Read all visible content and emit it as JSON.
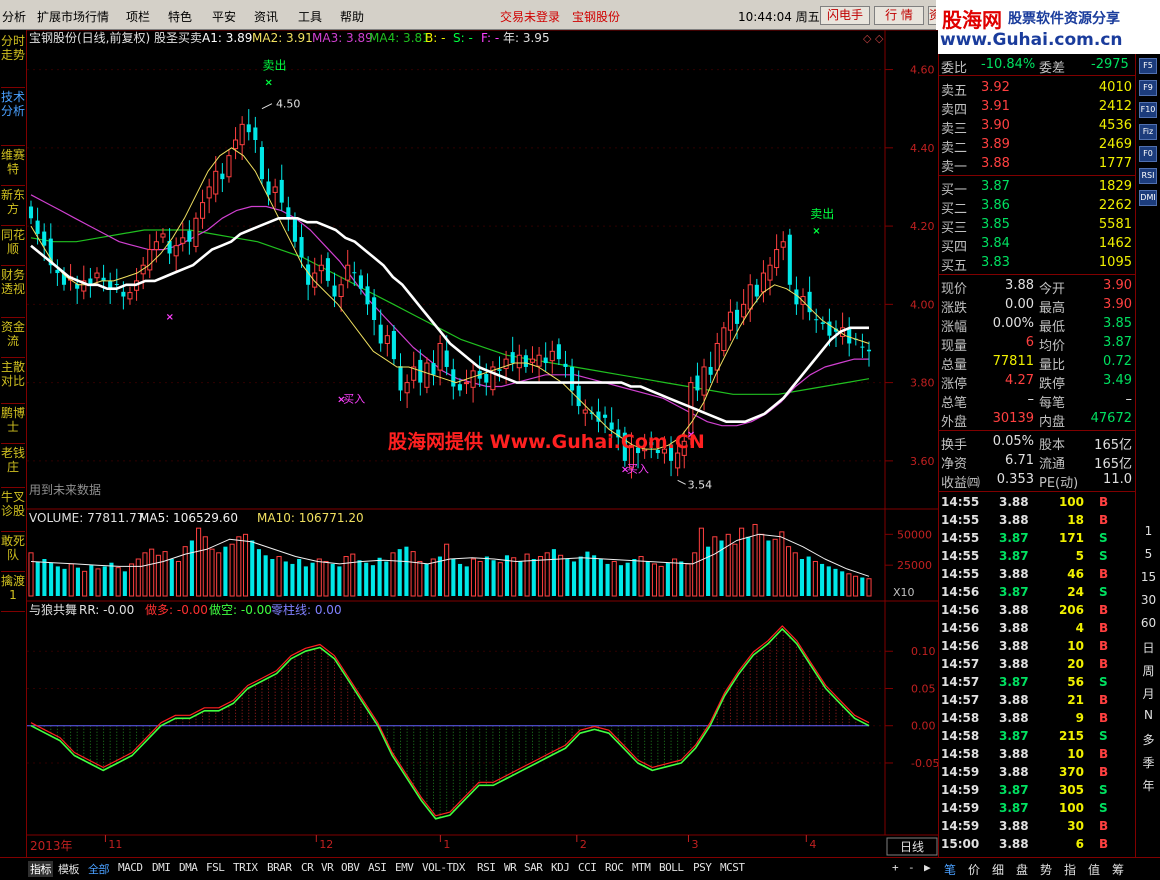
{
  "menu": {
    "items": [
      "分析",
      "扩展市场行情",
      "项栏",
      "特色",
      "平安",
      "资讯",
      "工具",
      "帮助"
    ],
    "trade_status": "交易未登录",
    "stock_name": "宝钢股份",
    "clock": "10:44:04 周五",
    "buttons": [
      "闪电手",
      "行 情",
      "资"
    ]
  },
  "logo": {
    "brand": "股海网",
    "slogan": "股票软件资源分享",
    "url": "www.Guhai.com.cn"
  },
  "left_tabs": [
    "分时走势",
    "技术分析",
    "维赛特",
    "新东方",
    "同花顺",
    "财务透视",
    "资金流",
    "主散对比",
    "鹏博士",
    "老钱庄",
    "牛叉诊股",
    "敢死队",
    "擒渡1"
  ],
  "main_header": {
    "title": "宝钢股份(日线,前复权) 股圣买卖",
    "a1": "A1: 3.89",
    "ma2": "MA2: 3.91",
    "ma3": "MA3: 3.89",
    "ma4": "MA4: 3.81",
    "b": "B: -",
    "s": "S: -",
    "f": "F: -",
    "year": "年: 3.95",
    "future_note": "用到未来数据",
    "watermark": "股海网提供 Www.Guhai.Com.CN"
  },
  "annotations": {
    "sell": "卖出",
    "buy": "买入",
    "high": "4.50",
    "low": "3.54",
    "corner_icons": "◇ ◇"
  },
  "volume_header": {
    "label": "VOLUME: 77811.77",
    "ma5": "MA5: 106529.60",
    "ma10": "MA10: 106771.20",
    "unit": "X10"
  },
  "osc_header": {
    "label": "与狼共舞",
    "rr": "RR: -0.00",
    "long": "做多: -0.00",
    "short": "做空: -0.00",
    "zero": "零柱线: 0.00"
  },
  "time_axis": {
    "year_label": "2013年",
    "months": [
      "11",
      "12",
      "1",
      "2",
      "3",
      "4"
    ],
    "period": "日线"
  },
  "colors": {
    "up": "#ff4040",
    "down": "#00e8e8",
    "ma_white": "#ffffff",
    "ma_yellow": "#f0e060",
    "ma_magenta": "#d040d0",
    "ma_green": "#20c020",
    "sell_signal": "#00ff40",
    "buy_signal": "#ff40ff",
    "osc_red": "#ff2020",
    "osc_green": "#40ff40",
    "zero_line": "#6060ff"
  },
  "quote": {
    "weibi": {
      "label": "委比",
      "value": "-10.84%",
      "weicha_label": "委差",
      "weicha": "-2975"
    },
    "asks": [
      {
        "label": "卖五",
        "price": "3.92",
        "vol": "4010"
      },
      {
        "label": "卖四",
        "price": "3.91",
        "vol": "2412"
      },
      {
        "label": "卖三",
        "price": "3.90",
        "vol": "4536"
      },
      {
        "label": "卖二",
        "price": "3.89",
        "vol": "2469"
      },
      {
        "label": "卖一",
        "price": "3.88",
        "vol": "1777"
      }
    ],
    "bids": [
      {
        "label": "买一",
        "price": "3.87",
        "vol": "1829"
      },
      {
        "label": "买二",
        "price": "3.86",
        "vol": "2262"
      },
      {
        "label": "买三",
        "price": "3.85",
        "vol": "5581"
      },
      {
        "label": "买四",
        "price": "3.84",
        "vol": "1462"
      },
      {
        "label": "买五",
        "price": "3.83",
        "vol": "1095"
      }
    ],
    "stats": [
      {
        "l1": "现价",
        "v1": "3.88",
        "c1": "wht",
        "l2": "今开",
        "v2": "3.90",
        "c2": "red"
      },
      {
        "l1": "涨跌",
        "v1": "0.00",
        "c1": "wht",
        "l2": "最高",
        "v2": "3.90",
        "c2": "red"
      },
      {
        "l1": "涨幅",
        "v1": "0.00%",
        "c1": "wht",
        "l2": "最低",
        "v2": "3.85",
        "c2": "grn"
      },
      {
        "l1": "现量",
        "v1": "6",
        "c1": "red",
        "l2": "均价",
        "v2": "3.87",
        "c2": "grn"
      },
      {
        "l1": "总量",
        "v1": "77811",
        "c1": "yel",
        "l2": "量比",
        "v2": "0.72",
        "c2": "grn"
      },
      {
        "l1": "涨停",
        "v1": "4.27",
        "c1": "red",
        "l2": "跌停",
        "v2": "3.49",
        "c2": "grn"
      },
      {
        "l1": "总笔",
        "v1": "–",
        "c1": "wht",
        "l2": "每笔",
        "v2": "–",
        "c2": "wht"
      },
      {
        "l1": "外盘",
        "v1": "30139",
        "c1": "red",
        "l2": "内盘",
        "v2": "47672",
        "c2": "grn"
      }
    ],
    "fin": [
      {
        "l1": "换手",
        "v1": "0.05%",
        "l2": "股本",
        "v2": "165亿"
      },
      {
        "l1": "净资",
        "v1": "6.71",
        "l2": "流通",
        "v2": "165亿"
      },
      {
        "l1": "收益㈣",
        "v1": "0.353",
        "l2": "PE(动)",
        "v2": "11.0"
      }
    ],
    "ticks": [
      {
        "t": "14:55",
        "p": "3.88",
        "v": "100",
        "s": "B"
      },
      {
        "t": "14:55",
        "p": "3.88",
        "v": "18",
        "s": "B"
      },
      {
        "t": "14:55",
        "p": "3.87",
        "v": "171",
        "s": "S"
      },
      {
        "t": "14:55",
        "p": "3.87",
        "v": "5",
        "s": "S"
      },
      {
        "t": "14:55",
        "p": "3.88",
        "v": "46",
        "s": "B"
      },
      {
        "t": "14:56",
        "p": "3.87",
        "v": "24",
        "s": "S"
      },
      {
        "t": "14:56",
        "p": "3.88",
        "v": "206",
        "s": "B"
      },
      {
        "t": "14:56",
        "p": "3.88",
        "v": "4",
        "s": "B"
      },
      {
        "t": "14:56",
        "p": "3.88",
        "v": "10",
        "s": "B"
      },
      {
        "t": "14:57",
        "p": "3.88",
        "v": "20",
        "s": "B"
      },
      {
        "t": "14:57",
        "p": "3.87",
        "v": "56",
        "s": "S"
      },
      {
        "t": "14:57",
        "p": "3.88",
        "v": "21",
        "s": "B"
      },
      {
        "t": "14:58",
        "p": "3.88",
        "v": "9",
        "s": "B"
      },
      {
        "t": "14:58",
        "p": "3.87",
        "v": "215",
        "s": "S"
      },
      {
        "t": "14:58",
        "p": "3.88",
        "v": "10",
        "s": "B"
      },
      {
        "t": "14:59",
        "p": "3.88",
        "v": "370",
        "s": "B"
      },
      {
        "t": "14:59",
        "p": "3.87",
        "v": "305",
        "s": "S"
      },
      {
        "t": "14:59",
        "p": "3.87",
        "v": "100",
        "s": "S"
      },
      {
        "t": "14:59",
        "p": "3.88",
        "v": "30",
        "s": "B"
      },
      {
        "t": "15:00",
        "p": "3.88",
        "v": "6",
        "s": "B"
      }
    ]
  },
  "right_icons": [
    "F5",
    "F9",
    "F10",
    "Fiz",
    "F0",
    "RSI",
    "DMI"
  ],
  "right_periods": [
    "1",
    "5",
    "15",
    "30",
    "60",
    "日",
    "周",
    "月",
    "N",
    "多",
    "季",
    "年"
  ],
  "bottom_tabs": [
    "指标",
    "模板",
    "全部",
    "MACD",
    "DMI",
    "DMA",
    "FSL",
    "TRIX",
    "BRAR",
    "CR",
    "VR",
    "OBV",
    "ASI",
    "EMV",
    "VOL-TDX",
    "RSI",
    "WR",
    "SAR",
    "KDJ",
    "CCI",
    "ROC",
    "MTM",
    "BOLL",
    "PSY",
    "MCST"
  ],
  "bottom_right": [
    "笔",
    "价",
    "细",
    "盘",
    "势",
    "指",
    "值",
    "筹"
  ],
  "bottom_nav": [
    "+",
    "-",
    "▶"
  ],
  "chart_data": [
    {
      "type": "candlestick",
      "title": "宝钢股份(日线,前复权) 股圣买卖",
      "ylim": [
        3.5,
        4.65
      ],
      "yticks": [
        3.6,
        3.8,
        4.0,
        4.2,
        4.4,
        4.6
      ],
      "ytick_labels": [
        "3.60",
        "3.80",
        "4.00",
        "4.20",
        "4.40",
        "4.60"
      ],
      "closes": [
        4.22,
        4.18,
        4.15,
        4.1,
        4.08,
        4.05,
        4.07,
        4.04,
        4.06,
        4.05,
        4.08,
        4.06,
        4.04,
        4.05,
        4.02,
        4.03,
        4.06,
        4.1,
        4.14,
        4.16,
        4.18,
        4.13,
        4.15,
        4.17,
        4.16,
        4.22,
        4.26,
        4.3,
        4.34,
        4.32,
        4.38,
        4.42,
        4.46,
        4.44,
        4.42,
        4.32,
        4.28,
        4.3,
        4.26,
        4.22,
        4.16,
        4.12,
        4.05,
        4.08,
        4.1,
        4.06,
        4.02,
        4.05,
        4.1,
        4.08,
        4.04,
        4.0,
        3.96,
        3.9,
        3.92,
        3.86,
        3.78,
        3.8,
        3.84,
        3.8,
        3.85,
        3.82,
        3.9,
        3.84,
        3.79,
        3.78,
        3.8,
        3.83,
        3.81,
        3.8,
        3.84,
        3.83,
        3.86,
        3.85,
        3.87,
        3.84,
        3.86,
        3.87,
        3.85,
        3.88,
        3.86,
        3.84,
        3.78,
        3.74,
        3.73,
        3.72,
        3.7,
        3.71,
        3.68,
        3.66,
        3.6,
        3.64,
        3.62,
        3.63,
        3.64,
        3.62,
        3.63,
        3.6,
        3.62,
        3.65,
        3.8,
        3.78,
        3.84,
        3.82,
        3.9,
        3.94,
        3.98,
        3.95,
        4.0,
        4.05,
        4.02,
        4.08,
        4.1,
        4.14,
        4.16,
        4.05,
        4.0,
        4.02,
        3.98,
        3.96,
        3.95,
        3.92,
        3.93,
        3.94,
        3.9,
        3.91,
        3.89,
        3.88
      ],
      "ma_white": [
        4.15,
        4.13,
        4.11,
        4.09,
        4.07,
        4.06,
        4.05,
        4.05,
        4.04,
        4.04,
        4.05,
        4.05,
        4.06,
        4.06,
        4.07,
        4.08,
        4.09,
        4.1,
        4.12,
        4.14,
        4.15,
        4.16,
        4.18,
        4.19,
        4.2,
        4.21,
        4.22,
        4.22,
        4.22,
        4.21,
        4.21,
        4.2,
        4.19,
        4.17,
        4.16,
        4.14,
        4.12,
        4.1,
        4.07,
        4.05,
        4.02,
        3.99,
        3.96,
        3.93,
        3.9,
        3.88,
        3.86,
        3.84,
        3.83,
        3.82,
        3.81,
        3.8,
        3.8,
        3.8,
        3.8,
        3.8,
        3.8,
        3.8,
        3.8,
        3.8,
        3.8,
        3.8,
        3.8,
        3.79,
        3.79,
        3.78,
        3.77,
        3.76,
        3.75,
        3.74,
        3.73,
        3.72,
        3.71,
        3.7,
        3.7,
        3.7,
        3.71,
        3.72,
        3.74,
        3.76,
        3.79,
        3.82,
        3.85,
        3.88,
        3.91,
        3.93,
        3.94,
        3.94,
        3.94
      ],
      "ma_yellow": [
        4.2,
        4.15,
        4.1,
        4.07,
        4.05,
        4.05,
        4.06,
        4.06,
        4.07,
        4.08,
        4.1,
        4.13,
        4.17,
        4.22,
        4.28,
        4.34,
        4.38,
        4.4,
        4.38,
        4.34,
        4.28,
        4.22,
        4.16,
        4.1,
        4.06,
        4.03,
        4.0,
        3.96,
        3.92,
        3.88,
        3.86,
        3.84,
        3.84,
        3.83,
        3.82,
        3.81,
        3.8,
        3.81,
        3.82,
        3.83,
        3.84,
        3.85,
        3.85,
        3.84,
        3.82,
        3.8,
        3.77,
        3.74,
        3.71,
        3.68,
        3.66,
        3.64,
        3.63,
        3.63,
        3.64,
        3.66,
        3.7,
        3.75,
        3.82,
        3.88,
        3.94,
        3.99,
        4.03,
        4.05,
        4.04,
        4.02,
        3.99,
        3.96,
        3.94,
        3.92,
        3.91,
        3.9
      ],
      "ma_magenta": [
        4.28,
        4.26,
        4.24,
        4.22,
        4.2,
        4.18,
        4.16,
        4.15,
        4.14,
        4.14,
        4.15,
        4.17,
        4.19,
        4.22,
        4.24,
        4.25,
        4.25,
        4.24,
        4.22,
        4.19,
        4.15,
        4.11,
        4.06,
        4.01,
        3.97,
        3.93,
        3.89,
        3.86,
        3.83,
        3.81,
        3.8,
        3.79,
        3.79,
        3.8,
        3.81,
        3.82,
        3.82,
        3.82,
        3.81,
        3.8,
        3.79,
        3.78,
        3.77,
        3.76,
        3.74,
        3.72,
        3.7,
        3.69,
        3.69,
        3.7,
        3.72,
        3.75,
        3.79,
        3.82,
        3.84,
        3.85,
        3.86,
        3.86
      ],
      "ma_green": [
        4.17,
        4.16,
        4.16,
        4.17,
        4.18,
        4.19,
        4.19,
        4.19,
        4.18,
        4.17,
        4.16,
        4.14,
        4.12,
        4.09,
        4.06,
        4.03,
        4.0,
        3.97,
        3.94,
        3.91,
        3.89,
        3.87,
        3.86,
        3.85,
        3.84,
        3.83,
        3.82,
        3.81,
        3.8,
        3.79,
        3.78,
        3.77,
        3.77,
        3.77,
        3.78,
        3.79,
        3.8,
        3.81
      ],
      "buy_signals": [
        [
          21,
          3.97
        ],
        [
          47,
          3.76
        ],
        [
          90,
          3.58
        ],
        [
          100,
          3.67
        ]
      ],
      "sell_signals": [
        [
          36,
          4.57
        ],
        [
          119,
          4.19
        ]
      ],
      "high_label": {
        "index": 35,
        "value": 4.5
      },
      "low_label": {
        "index": 98,
        "value": 3.54
      }
    },
    {
      "type": "bar",
      "name": "VOLUME",
      "ylim": [
        0,
        60000
      ],
      "yticks": [
        25000,
        50000
      ],
      "ytick_labels": [
        "25000",
        "50000"
      ],
      "values": [
        35000,
        28000,
        30000,
        27000,
        24000,
        22000,
        26000,
        23000,
        20000,
        25000,
        22000,
        24000,
        27000,
        23000,
        20000,
        26000,
        30000,
        35000,
        38000,
        33000,
        36000,
        30000,
        28000,
        40000,
        45000,
        55000,
        48000,
        38000,
        35000,
        40000,
        42000,
        48000,
        50000,
        45000,
        38000,
        33000,
        30000,
        32000,
        28000,
        26000,
        30000,
        24000,
        27000,
        30000,
        28000,
        26000,
        24000,
        32000,
        34000,
        29000,
        27000,
        25000,
        31000,
        28000,
        35000,
        38000,
        40000,
        36000,
        28000,
        26000,
        30000,
        32000,
        42000,
        30000,
        26000,
        24000,
        30000,
        28000,
        32000,
        29000,
        27000,
        33000,
        31000,
        28000,
        34000,
        30000,
        32000,
        35000,
        38000,
        33000,
        30000,
        28000,
        32000,
        36000,
        33000,
        30000,
        26000,
        28000,
        25000,
        27000,
        30000,
        32000,
        28000,
        26000,
        24000,
        27000,
        30000,
        28000,
        26000,
        35000,
        55000,
        40000,
        48000,
        45000,
        50000,
        42000,
        55000,
        48000,
        58000,
        50000,
        45000,
        46000,
        52000,
        40000,
        35000,
        30000,
        32000,
        28000,
        26000,
        24000,
        22000,
        20000,
        18000,
        16000,
        15000,
        14000
      ],
      "ma5": [
        28000,
        27000,
        26000,
        25000,
        24000,
        24000,
        28000,
        34000,
        38000,
        46000,
        44000,
        38000,
        32000,
        28000,
        26000,
        28000,
        29000,
        28000,
        26000,
        30000,
        31000,
        30000,
        28000,
        29000,
        30000,
        31000,
        30000,
        29000,
        28000,
        27000,
        26000,
        34000,
        45000,
        50000,
        48000,
        40000,
        30000,
        22000,
        16000
      ]
    },
    {
      "type": "area",
      "name": "与狼共舞",
      "ylim": [
        -0.14,
        0.15
      ],
      "yticks": [
        -0.05,
        0.0,
        0.05,
        0.1
      ],
      "ytick_labels": [
        "-0.05",
        "0.00",
        "0.05",
        "0.10"
      ],
      "values": [
        0,
        -0.01,
        -0.02,
        -0.04,
        -0.05,
        -0.06,
        -0.05,
        -0.04,
        -0.02,
        0,
        0.01,
        0.01,
        0.02,
        0.02,
        0.03,
        0.05,
        0.06,
        0.07,
        0.09,
        0.1,
        0.105,
        0.09,
        0.06,
        0.03,
        0,
        -0.04,
        -0.07,
        -0.1,
        -0.125,
        -0.12,
        -0.1,
        -0.08,
        -0.08,
        -0.07,
        -0.06,
        -0.05,
        -0.04,
        -0.03,
        -0.01,
        -0.005,
        -0.01,
        -0.03,
        -0.05,
        -0.06,
        -0.055,
        -0.05,
        -0.03,
        0,
        0.04,
        0.07,
        0.095,
        0.11,
        0.13,
        0.11,
        0.08,
        0.05,
        0.03,
        0.01,
        0
      ]
    }
  ]
}
